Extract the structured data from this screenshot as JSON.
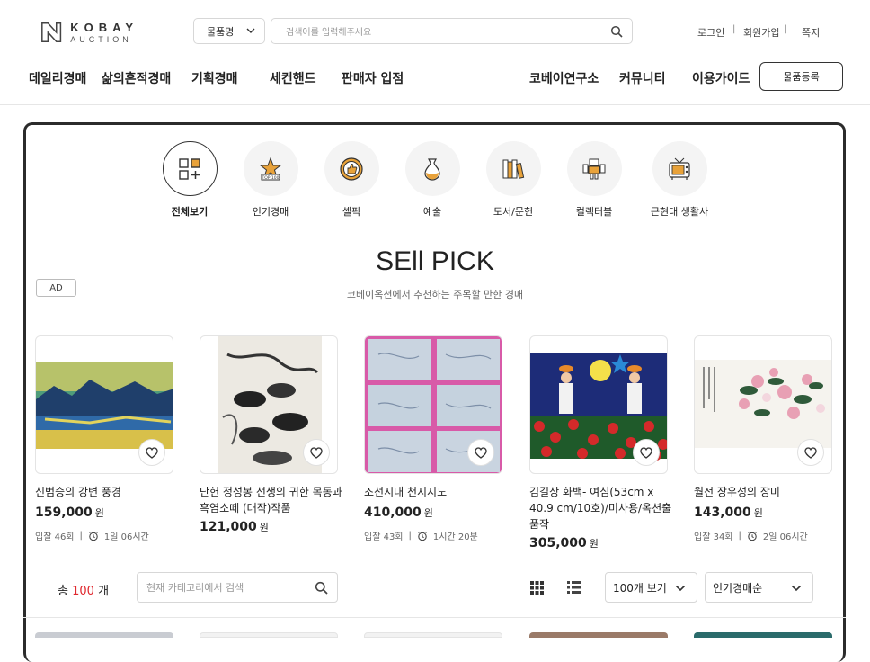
{
  "header": {
    "logo": {
      "line1": "KOBAY",
      "line2": "AUCTION"
    },
    "search_type": "물품명",
    "search_placeholder": "검색어를 입력해주세요",
    "util": {
      "login": "로그인",
      "signup": "회원가입",
      "note": "쪽지"
    },
    "nav_left": [
      "데일리경매",
      "삶의흔적경매",
      "기획경매",
      "세컨핸드",
      "판매자 입점"
    ],
    "nav_right": [
      "코베이연구소",
      "커뮤니티",
      "이용가이드"
    ],
    "register_button": "물품등록"
  },
  "categories": [
    {
      "label": "전체보기",
      "icon": "grid-plus-icon",
      "active": true
    },
    {
      "label": "인기경매",
      "icon": "top100-star-icon",
      "active": false
    },
    {
      "label": "셀픽",
      "icon": "thumbs-up-badge-icon",
      "active": false
    },
    {
      "label": "예술",
      "icon": "vase-icon",
      "active": false
    },
    {
      "label": "도서/문헌",
      "icon": "books-icon",
      "active": false
    },
    {
      "label": "컬렉터블",
      "icon": "robot-toy-icon",
      "active": false
    },
    {
      "label": "근현대 생활사",
      "icon": "retro-tv-icon",
      "active": false
    }
  ],
  "section": {
    "ad_badge": "AD",
    "title": "SEll PICK",
    "subtitle": "코베이옥션에서 추천하는 주목할 만한 경매"
  },
  "products": [
    {
      "name": "신범승의 강변 풍경",
      "price": "159,000",
      "currency": "원",
      "bids": "입찰 46회",
      "time": "1일 06시간",
      "image": "landscape-painting"
    },
    {
      "name": "단헌 정성봉 선생의 귀한 목동과 흑염소떼 (대작)작품",
      "price": "121,000",
      "currency": "원",
      "bids": "",
      "time": "",
      "image": "ink-goats-painting"
    },
    {
      "name": "조선시대 천지지도",
      "price": "410,000",
      "currency": "원",
      "bids": "입찰 43회",
      "time": "1시간 20분",
      "image": "old-maps"
    },
    {
      "name": "김길상 화백- 여심(53cm x 40.9 cm/10호)/미사용/옥션출품작",
      "price": "305,000",
      "currency": "원",
      "bids": "",
      "time": "",
      "image": "women-flowers-painting"
    },
    {
      "name": "월전 장우성의 장미",
      "price": "143,000",
      "currency": "원",
      "bids": "입찰 34회",
      "time": "2일 06시간",
      "image": "rose-painting"
    }
  ],
  "list_bar": {
    "total_prefix": "총",
    "total_count": "100",
    "total_suffix": "개",
    "category_search_placeholder": "현재 카테고리에서 검색",
    "per_page": "100개 보기",
    "sort": "인기경매순"
  },
  "colors": {
    "accent_red": "#e0282e",
    "panel_border": "#2b2b2b",
    "icon_orange": "#e8a23a"
  }
}
